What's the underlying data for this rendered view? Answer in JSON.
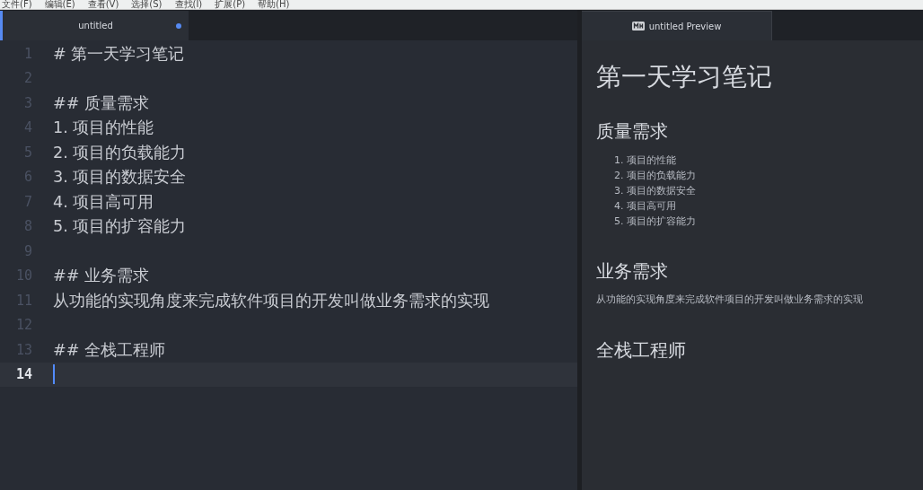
{
  "menu": [
    "文件(F)",
    "编辑(E)",
    "查看(V)",
    "选择(S)",
    "查找(I)",
    "扩展(P)",
    "帮助(H)"
  ],
  "editor_tab": {
    "title": "untitled",
    "modified": true,
    "selected": true
  },
  "preview_tab": {
    "title": "untitled Preview",
    "selected": true
  },
  "lines": [
    {
      "number": "1",
      "text": "# 第一天学习笔记",
      "current": false
    },
    {
      "number": "2",
      "current": false
    },
    {
      "number": "3",
      "text": "## 质量需求",
      "current": false
    },
    {
      "number": "4",
      "text": "1. 项目的性能",
      "current": false
    },
    {
      "number": "5",
      "text": "2. 项目的负载能力",
      "current": false
    },
    {
      "number": "6",
      "text": "3. 项目的数据安全",
      "current": false
    },
    {
      "number": "7",
      "text": "4. 项目高可用",
      "current": false
    },
    {
      "number": "8",
      "text": "5. 项目的扩容能力",
      "current": false
    },
    {
      "number": "9",
      "current": false
    },
    {
      "number": "10",
      "text": "## 业务需求",
      "current": false
    },
    {
      "number": "11",
      "text": "从功能的实现角度来完成软件项目的开发叫做业务需求的实现",
      "current": false
    },
    {
      "number": "12",
      "current": false
    },
    {
      "number": "13",
      "text": "## 全栈工程师",
      "current": false
    },
    {
      "number": "14",
      "current": true
    }
  ],
  "preview": [
    {
      "kind": "h1",
      "text": "第一天学习笔记"
    },
    {
      "kind": "h2",
      "text": "质量需求"
    },
    {
      "kind": "ol",
      "items": [
        "1. 项目的性能",
        "2. 项目的负载能力",
        "3. 项目的数据安全",
        "4. 项目高可用",
        "5. 项目的扩容能力"
      ]
    },
    {
      "kind": "h2",
      "text": "业务需求"
    },
    {
      "kind": "p",
      "text": "从功能的实现角度来完成软件项目的开发叫做业务需求的实现"
    },
    {
      "kind": "h2",
      "text": "全栈工程师"
    }
  ]
}
